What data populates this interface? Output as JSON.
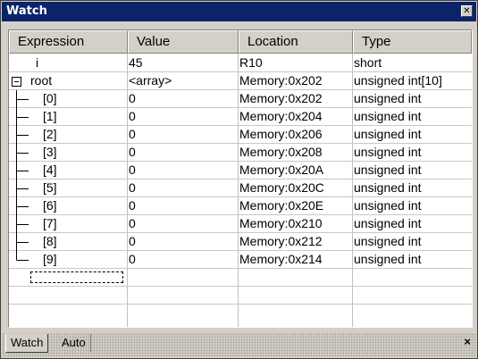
{
  "window": {
    "title": "Watch"
  },
  "columns": [
    "Expression",
    "Value",
    "Location",
    "Type"
  ],
  "rows": [
    {
      "expression": "i",
      "value": "45",
      "location": "R10",
      "type": "short",
      "tree": "none"
    },
    {
      "expression": "root",
      "value": "<array>",
      "location": "Memory:0x202",
      "type": "unsigned int[10]",
      "tree": "expanded"
    },
    {
      "expression": "[0]",
      "value": "0",
      "location": "Memory:0x202",
      "type": "unsigned int",
      "tree": "branch"
    },
    {
      "expression": "[1]",
      "value": "0",
      "location": "Memory:0x204",
      "type": "unsigned int",
      "tree": "branch"
    },
    {
      "expression": "[2]",
      "value": "0",
      "location": "Memory:0x206",
      "type": "unsigned int",
      "tree": "branch"
    },
    {
      "expression": "[3]",
      "value": "0",
      "location": "Memory:0x208",
      "type": "unsigned int",
      "tree": "branch"
    },
    {
      "expression": "[4]",
      "value": "0",
      "location": "Memory:0x20A",
      "type": "unsigned int",
      "tree": "branch"
    },
    {
      "expression": "[5]",
      "value": "0",
      "location": "Memory:0x20C",
      "type": "unsigned int",
      "tree": "branch"
    },
    {
      "expression": "[6]",
      "value": "0",
      "location": "Memory:0x20E",
      "type": "unsigned int",
      "tree": "branch"
    },
    {
      "expression": "[7]",
      "value": "0",
      "location": "Memory:0x210",
      "type": "unsigned int",
      "tree": "branch"
    },
    {
      "expression": "[8]",
      "value": "0",
      "location": "Memory:0x212",
      "type": "unsigned int",
      "tree": "branch"
    },
    {
      "expression": "[9]",
      "value": "0",
      "location": "Memory:0x214",
      "type": "unsigned int",
      "tree": "last"
    }
  ],
  "tabs": {
    "watch": "Watch",
    "auto": "Auto"
  },
  "icons": {
    "close": "close-icon",
    "collapse": "minus-box-icon"
  }
}
